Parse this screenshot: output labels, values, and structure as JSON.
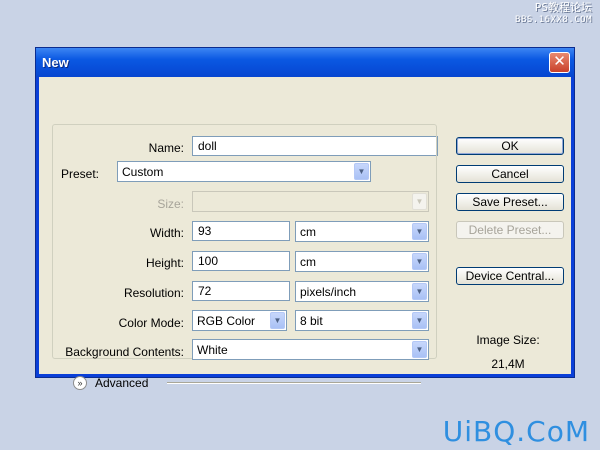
{
  "watermark": {
    "top_line1": "PS教程论坛",
    "top_line2": "BBS.16XX8.COM",
    "bottom": "UiBQ.CoM"
  },
  "dialog": {
    "title": "New",
    "close_glyph": "✕",
    "name": {
      "label": "Name:",
      "value": "doll"
    },
    "preset": {
      "label": "Preset:",
      "value": "Custom"
    },
    "size": {
      "label": "Size:",
      "value": ""
    },
    "width": {
      "label": "Width:",
      "value": "93",
      "unit": "cm"
    },
    "height": {
      "label": "Height:",
      "value": "100",
      "unit": "cm"
    },
    "resolution": {
      "label": "Resolution:",
      "value": "72",
      "unit": "pixels/inch"
    },
    "color_mode": {
      "label": "Color Mode:",
      "value": "RGB Color",
      "depth": "8 bit"
    },
    "background": {
      "label": "Background Contents:",
      "value": "White"
    },
    "advanced": {
      "label": "Advanced"
    },
    "buttons": {
      "ok": "OK",
      "cancel": "Cancel",
      "save_preset": "Save Preset...",
      "delete_preset": "Delete Preset...",
      "device_central": "Device Central..."
    },
    "image_size": {
      "label": "Image Size:",
      "value": "21,4M"
    }
  },
  "colors": {
    "titlebar": "#0a58e2",
    "dialog_bg": "#ece9d8",
    "desktop": "#c9d3e6",
    "watermark_blue": "#2f8fe0"
  },
  "icons": {
    "dropdown": "chevron-down-icon",
    "advanced": "expand-chevron-icon"
  }
}
